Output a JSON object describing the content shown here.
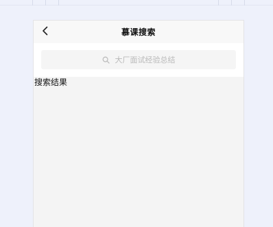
{
  "navbar": {
    "title": "慕课搜索",
    "back_icon": "chevron-left-icon"
  },
  "search": {
    "placeholder": "大厂面试经验总结",
    "icon": "search-icon"
  },
  "results": {
    "label": "搜索结果"
  },
  "colors": {
    "page_background": "#eef1fb",
    "navbar_background": "#f8f8f8",
    "search_box_background": "#f5f5f5",
    "content_background": "#f4f4f4",
    "placeholder_text": "#b9b9b9"
  }
}
